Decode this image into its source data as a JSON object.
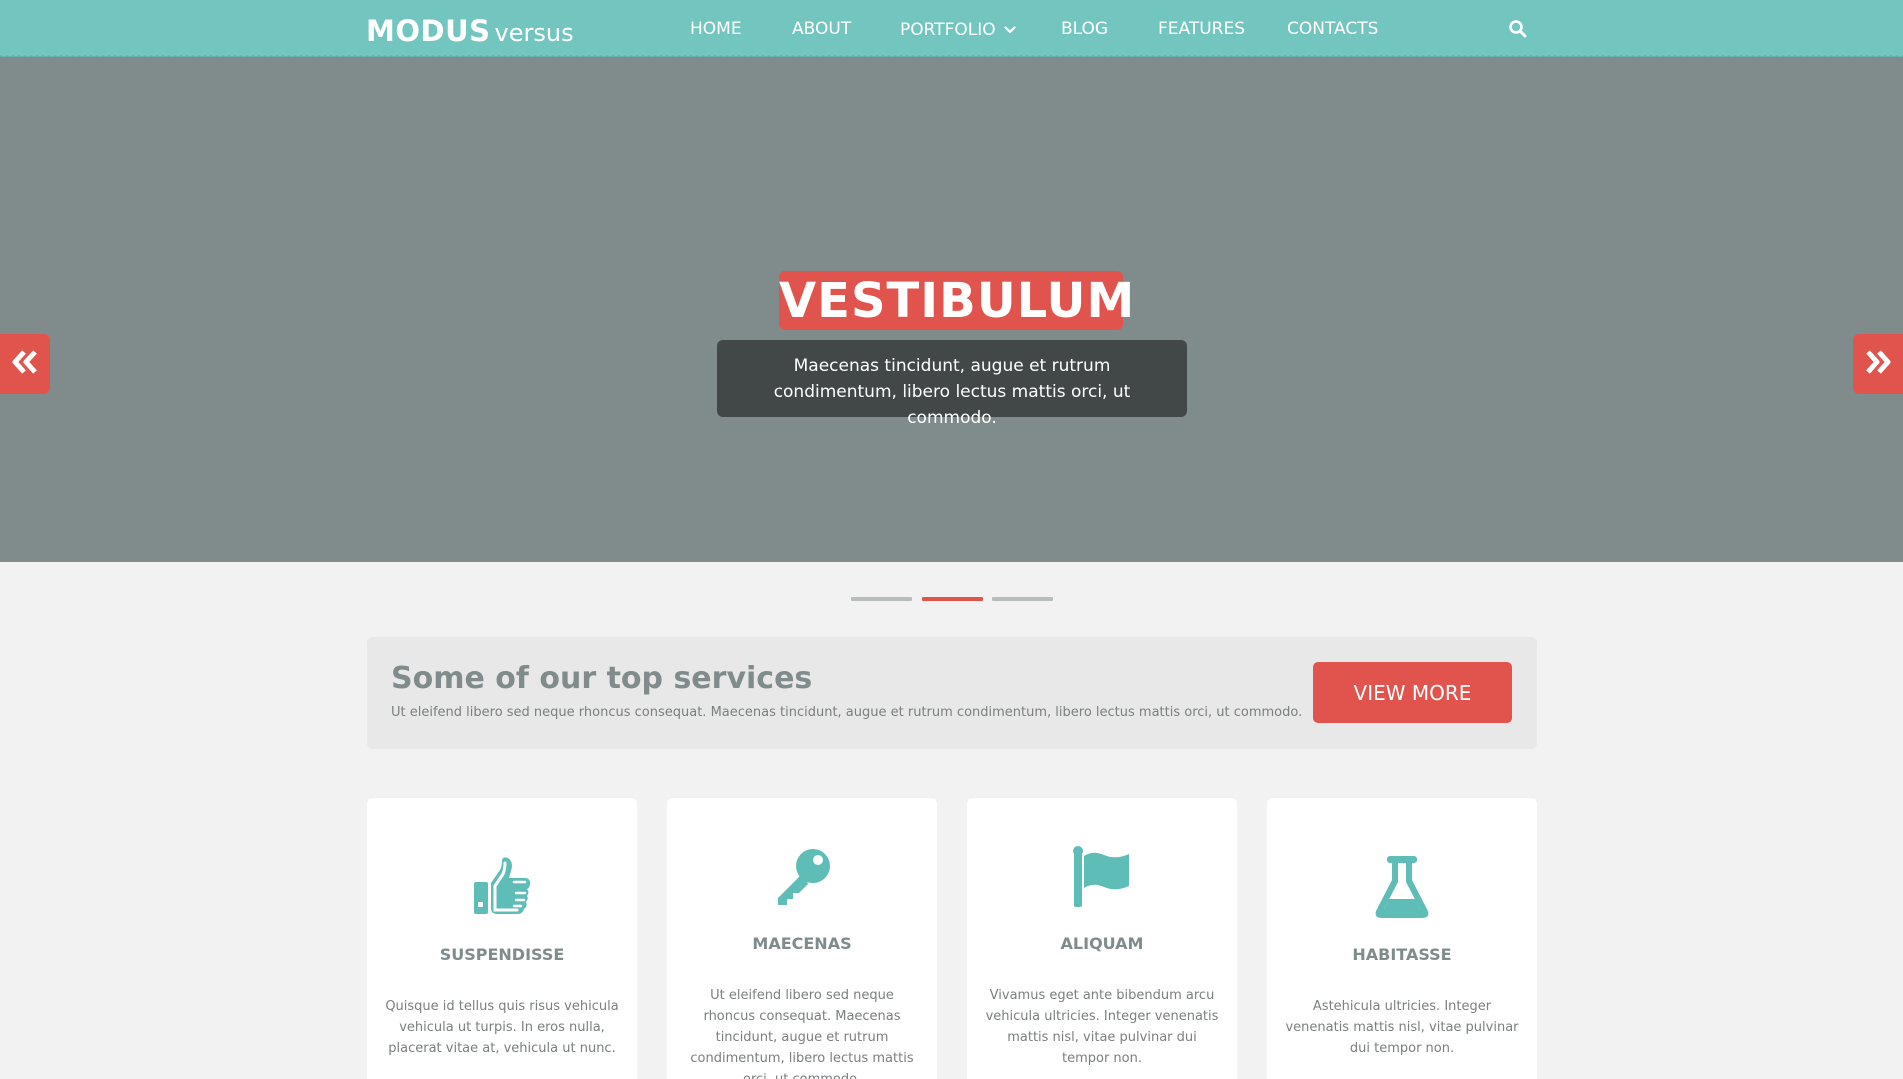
{
  "brand": {
    "bold": "MODUS",
    "light": "versus"
  },
  "nav": {
    "items": [
      "HOME",
      "ABOUT",
      "PORTFOLIO",
      "BLOG",
      "FEATURES",
      "CONTACTS"
    ],
    "search_icon": "search-icon",
    "dropdown_icon": "chevron-down-icon"
  },
  "hero": {
    "title": "VESTIBULUM",
    "caption": "Maecenas tincidunt, augue et rutrum condimentum, libero lectus mattis orci, ut commodo.",
    "prev_icon": "double-chevron-left-icon",
    "next_icon": "double-chevron-right-icon",
    "slides_total": 3,
    "active_slide": 2
  },
  "services": {
    "title": "Some of our top services",
    "text": "Ut eleifend libero sed neque rhoncus consequat. Maecenas tincidunt, augue et rutrum condimentum, libero lectus mattis orci, ut commodo.",
    "button": "VIEW MORE"
  },
  "cards": [
    {
      "icon": "thumbs-up-icon",
      "title": "SUSPENDISSE",
      "text": "Quisque id tellus quis risus vehicula vehicula ut turpis. In eros nulla, placerat vitae at, vehicula ut nunc."
    },
    {
      "icon": "key-icon",
      "title": "MAECENAS",
      "text": "Ut eleifend libero sed neque rhoncus consequat. Maecenas tincidunt, augue et rutrum condimentum, libero lectus mattis orci, ut commodo."
    },
    {
      "icon": "flag-icon",
      "title": "ALIQUAM",
      "text": "Vivamus eget ante bibendum arcu vehicula ultricies. Integer venenatis mattis nisl, vitae pulvinar dui tempor non."
    },
    {
      "icon": "flask-icon",
      "title": "HABITASSE",
      "text": "Astehicula ultricies. Integer venenatis mattis nisl, vitae pulvinar dui tempor non."
    }
  ],
  "colors": {
    "nav_bg": "#73c6bf",
    "hero_bg": "#7f8c8b",
    "accent_red": "#e1544e",
    "icon_teal": "#5fbdb8",
    "caption_bg": "#414847",
    "page_bg": "#f2f2f2"
  }
}
